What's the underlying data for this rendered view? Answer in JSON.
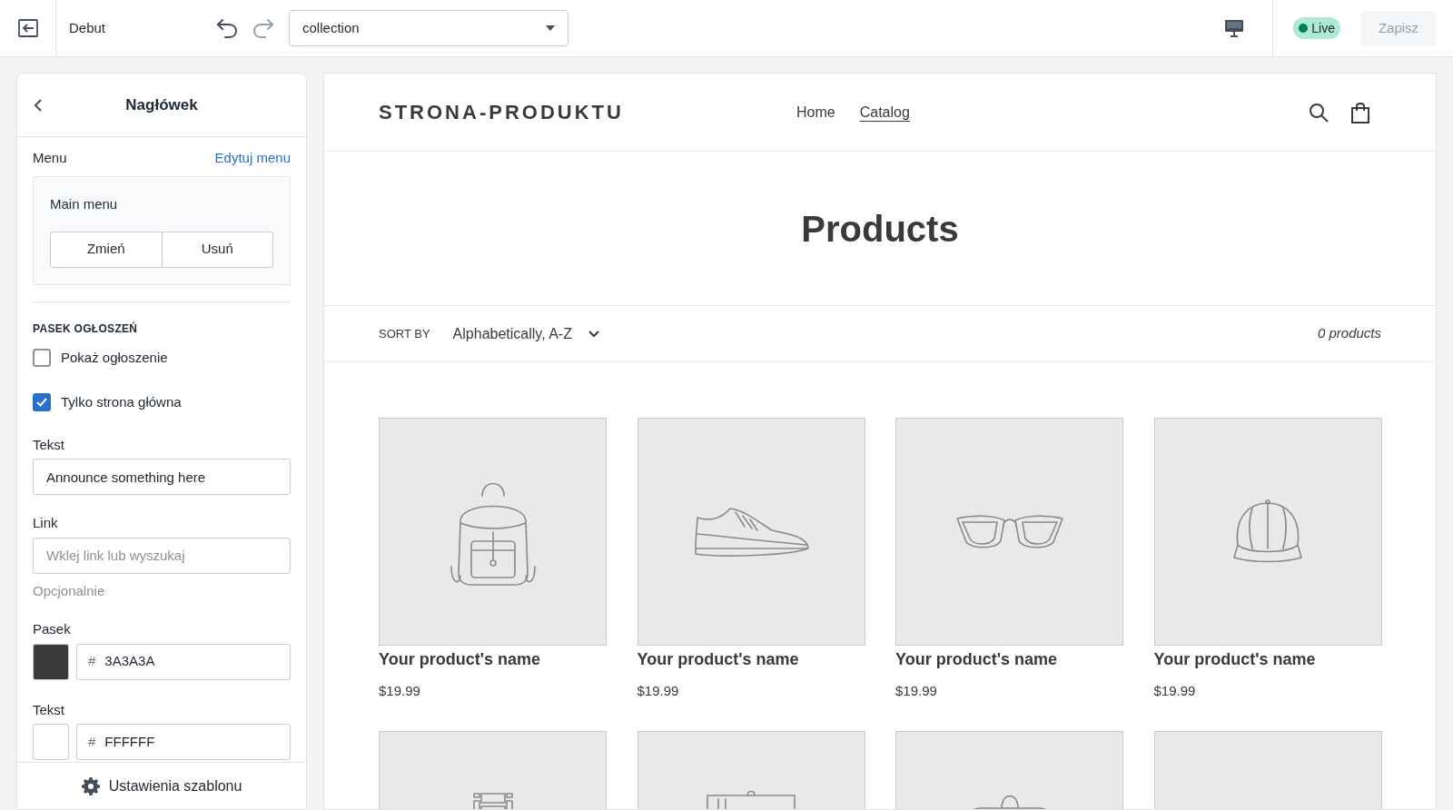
{
  "topbar": {
    "theme": "Debut",
    "template": "collection",
    "status": "Live",
    "save": "Zapisz",
    "save_disabled": true
  },
  "panel": {
    "title": "Nagłówek",
    "menu_label": "Menu",
    "menu_link": "Edytuj menu",
    "menu_name": "Main menu",
    "menu_buttons": [
      "Zmień",
      "Usuń"
    ],
    "section": "PASEK OGŁOSZEŃ",
    "checkboxes": [
      {
        "label": "Pokaż ogłoszenie",
        "checked": false
      },
      {
        "label": "Tylko strona główna",
        "checked": true
      }
    ],
    "text_label": "Tekst",
    "text_value": "Announce something here",
    "link_label": "Link",
    "link_placeholder": "Wklej link lub wyszukaj",
    "link_help": "Opcjonalnie",
    "colors": [
      {
        "label": "Pasek",
        "hash": "#",
        "value": "3A3A3A",
        "color": "#3a3a3a"
      },
      {
        "label": "Tekst",
        "hash": "#",
        "value": "FFFFFF",
        "color": "#ffffff"
      }
    ],
    "footer": "Ustawienia szablonu"
  },
  "store": {
    "logo": "STRONA-PRODUKTU",
    "nav": [
      {
        "label": "Home",
        "selected": false
      },
      {
        "label": "Catalog",
        "selected": true
      }
    ],
    "heading": "Products",
    "sort_label": "SORT BY",
    "sort_value": "Alphabetically, A-Z",
    "count": "0 products",
    "products": [
      {
        "kind": "backpack",
        "name": "Your product's name",
        "price": "$19.99"
      },
      {
        "kind": "shoe",
        "name": "Your product's name",
        "price": "$19.99"
      },
      {
        "kind": "glasses",
        "name": "Your product's name",
        "price": "$19.99"
      },
      {
        "kind": "cap",
        "name": "Your product's name",
        "price": "$19.99"
      },
      {
        "kind": "shelf"
      },
      {
        "kind": "box"
      },
      {
        "kind": "bag"
      },
      {
        "kind": "blank"
      }
    ]
  }
}
